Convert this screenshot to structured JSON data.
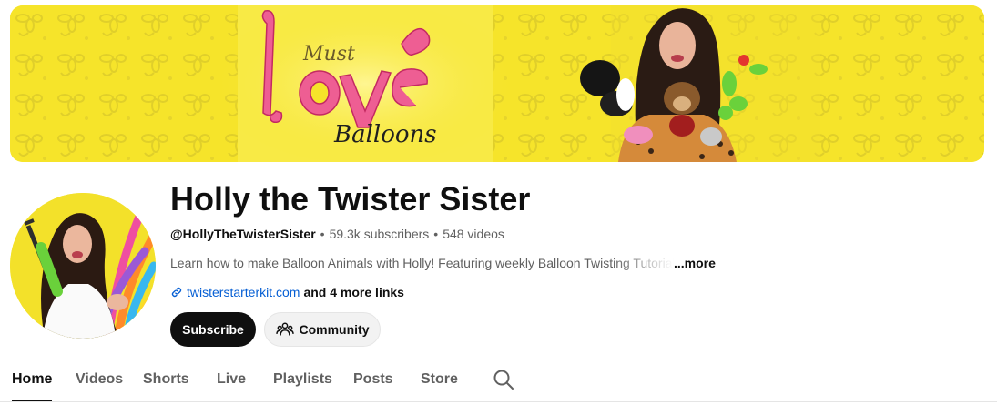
{
  "banner": {
    "script_word": "Must",
    "main_word": "love",
    "signature_word": "Balloons",
    "background_color": "#f6e42a",
    "accent_color": "#e8467f"
  },
  "channel": {
    "name": "Holly the Twister Sister",
    "handle": "@HollyTheTwisterSister",
    "separator": "•",
    "subscribers": "59.3k subscribers",
    "videos": "548 videos",
    "description": "Learn how to make Balloon Animals with Holly!  Featuring weekly Balloon Twisting Tutorials",
    "more_label": "...more",
    "link_text": "twisterstarterkit.com",
    "more_links": "and 4 more links"
  },
  "actions": {
    "subscribe_label": "Subscribe",
    "community_label": "Community"
  },
  "tabs": [
    {
      "label": "Home",
      "active": true
    },
    {
      "label": "Videos",
      "active": false
    },
    {
      "label": "Shorts",
      "active": false
    },
    {
      "label": "Live",
      "active": false
    },
    {
      "label": "Playlists",
      "active": false
    },
    {
      "label": "Posts",
      "active": false
    },
    {
      "label": "Store",
      "active": false
    }
  ],
  "icons": {
    "link": "link-icon",
    "community": "people-icon",
    "search": "search-icon"
  },
  "colors": {
    "text_primary": "#0f0f0f",
    "text_secondary": "#606060",
    "link_blue": "#065fd4",
    "subscribe_bg": "#0f0f0f",
    "community_bg": "#f2f2f2"
  }
}
